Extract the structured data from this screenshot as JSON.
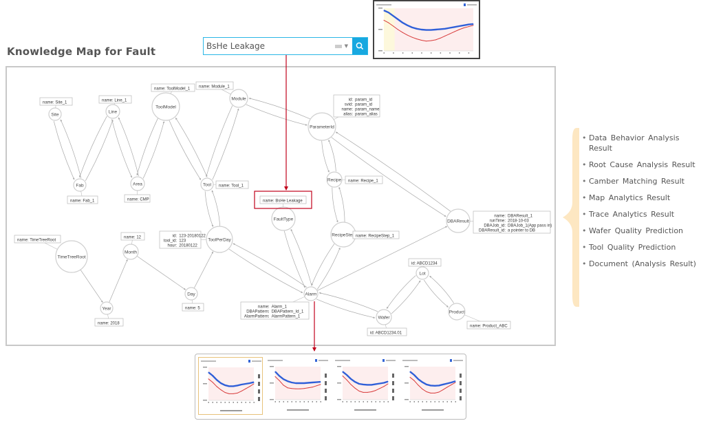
{
  "page": {
    "title": "Knowledge Map for Fault"
  },
  "search": {
    "value": "BsHe  Leakage",
    "icon": "search-icon"
  },
  "colors": {
    "accent": "#18a8e0",
    "highlight": "#c0001a",
    "node_stroke": "#cfcfcf",
    "edge": "#a8a8a8",
    "brace": "#fde7c2",
    "series_blue": "#2f5fd8",
    "series_red": "#d83a3a"
  },
  "graph": {
    "nodes": [
      {
        "id": "Site",
        "label": "Site"
      },
      {
        "id": "Line",
        "label": "Line"
      },
      {
        "id": "ToolModel",
        "label": "ToolModel"
      },
      {
        "id": "Module",
        "label": "Module"
      },
      {
        "id": "ParameterId",
        "label": "ParameterId"
      },
      {
        "id": "Fab",
        "label": "Fab"
      },
      {
        "id": "Area",
        "label": "Area"
      },
      {
        "id": "Tool",
        "label": "Tool"
      },
      {
        "id": "Recipe",
        "label": "Recipe"
      },
      {
        "id": "FaultType",
        "label": "FaultType"
      },
      {
        "id": "RecipeStep",
        "label": "RecipeStep"
      },
      {
        "id": "DBAResult",
        "label": "DBAResult"
      },
      {
        "id": "TimeTreeRoot",
        "label": "TimeTreeRoot"
      },
      {
        "id": "Month",
        "label": "Month"
      },
      {
        "id": "ToolPerDay",
        "label": "ToolPerDay"
      },
      {
        "id": "Year",
        "label": "Year"
      },
      {
        "id": "Day",
        "label": "Day"
      },
      {
        "id": "Alarm",
        "label": "Alarm"
      },
      {
        "id": "Lot",
        "label": "Lot"
      },
      {
        "id": "Wafer",
        "label": "Wafer"
      },
      {
        "id": "Product",
        "label": "Product"
      }
    ],
    "edges": [
      [
        "Site",
        "Fab"
      ],
      [
        "Fab",
        "Site"
      ],
      [
        "Line",
        "Fab"
      ],
      [
        "Fab",
        "Line"
      ],
      [
        "Line",
        "Area"
      ],
      [
        "Area",
        "Line"
      ],
      [
        "ToolModel",
        "Area"
      ],
      [
        "Area",
        "ToolModel"
      ],
      [
        "ToolModel",
        "Tool"
      ],
      [
        "Tool",
        "ToolModel"
      ],
      [
        "Module",
        "Tool"
      ],
      [
        "Tool",
        "Module"
      ],
      [
        "Module",
        "ParameterId"
      ],
      [
        "ParameterId",
        "Module"
      ],
      [
        "ParameterId",
        "Recipe"
      ],
      [
        "Recipe",
        "ParameterId"
      ],
      [
        "ParameterId",
        "DBAResult"
      ],
      [
        "DBAResult",
        "ParameterId"
      ],
      [
        "Recipe",
        "RecipeStep"
      ],
      [
        "RecipeStep",
        "Recipe"
      ],
      [
        "Tool",
        "ToolPerDay"
      ],
      [
        "ToolPerDay",
        "Tool"
      ],
      [
        "TimeTreeRoot",
        "Year"
      ],
      [
        "Year",
        "Month"
      ],
      [
        "Month",
        "Day"
      ],
      [
        "Day",
        "ToolPerDay"
      ],
      [
        "ToolPerDay",
        "Alarm"
      ],
      [
        "Alarm",
        "ToolPerDay"
      ],
      [
        "FaultType",
        "Alarm"
      ],
      [
        "Alarm",
        "FaultType"
      ],
      [
        "RecipeStep",
        "Alarm"
      ],
      [
        "Alarm",
        "RecipeStep"
      ],
      [
        "Alarm",
        "DBAResult"
      ],
      [
        "Wafer",
        "Alarm"
      ],
      [
        "Alarm",
        "Wafer"
      ],
      [
        "Lot",
        "Wafer"
      ],
      [
        "Wafer",
        "Lot"
      ],
      [
        "Lot",
        "Product"
      ],
      [
        "Product",
        "Lot"
      ]
    ],
    "properties": [
      {
        "node": "Site",
        "lines": [
          "name: Site_1"
        ]
      },
      {
        "node": "Line",
        "lines": [
          "name: Line_1"
        ]
      },
      {
        "node": "ToolModel",
        "lines": [
          "name: ToolModel_1"
        ]
      },
      {
        "node": "Module",
        "lines": [
          "name: Module_1"
        ]
      },
      {
        "node": "ParameterId",
        "lines": [
          "id: param_id",
          "svid: param_id",
          "name: param_name",
          "alias: param_alias"
        ]
      },
      {
        "node": "Fab",
        "lines": [
          "name: Fab_1"
        ]
      },
      {
        "node": "Area",
        "lines": [
          "name: CMP"
        ]
      },
      {
        "node": "Tool",
        "lines": [
          "name: Tool_1"
        ]
      },
      {
        "node": "Recipe",
        "lines": [
          "name: Recipe_1"
        ]
      },
      {
        "node": "FaultType",
        "lines": [
          "name: BsHe Leakage"
        ]
      },
      {
        "node": "RecipeStep",
        "lines": [
          "name: RecipeStep_1"
        ]
      },
      {
        "node": "DBAResult",
        "lines": [
          "name: DBAResult_1",
          "runTime: 2018-10-03",
          "DBAJob_id: DBAJob_1(App pass in)",
          "DBAResult_id: a pointer to DB"
        ]
      },
      {
        "node": "TimeTreeRoot",
        "lines": [
          "name: TimeTreeRoot"
        ]
      },
      {
        "node": "Month",
        "lines": [
          "name: 12"
        ]
      },
      {
        "node": "ToolPerDay",
        "lines": [
          "id: 123-20180122",
          "tool_id: 123",
          "hour: 20180122"
        ]
      },
      {
        "node": "Year",
        "lines": [
          "name: 2018"
        ]
      },
      {
        "node": "Day",
        "lines": [
          "name: 5"
        ]
      },
      {
        "node": "Alarm",
        "lines": [
          "name: Alarm_1",
          "DBAPattern: DBAPattern_Id_1",
          "AlarmPattern: AlarmPattern_1"
        ]
      },
      {
        "node": "Lot",
        "lines": [
          "id: ABCD1234"
        ]
      },
      {
        "node": "Wafer",
        "lines": [
          "id: ABCD1234.01"
        ]
      },
      {
        "node": "Product",
        "lines": [
          "name: Product_ABC"
        ]
      }
    ],
    "highlighted_property": "FaultType"
  },
  "results": {
    "items": [
      "Data Behavior Analysis Result",
      "Root Cause Analysis Result",
      "Camber Matching Result",
      "Map Analytics Result",
      "Trace Analytics Result",
      "Wafer Quality Prediction",
      "Tool Quality Prediction",
      "Document (Analysis Result)"
    ]
  },
  "chart_data": [
    {
      "type": "line",
      "title": "",
      "xlabel": "",
      "ylabel": "",
      "x": [
        1,
        2,
        3,
        4,
        5,
        6,
        7,
        8,
        9,
        10,
        11,
        12,
        13,
        14,
        15,
        16,
        17,
        18,
        19,
        20
      ],
      "series": [
        {
          "name": "upper",
          "color": "#2f5fd8",
          "values": [
            0.95,
            0.9,
            0.82,
            0.74,
            0.66,
            0.6,
            0.55,
            0.52,
            0.5,
            0.49,
            0.49,
            0.5,
            0.51,
            0.52,
            0.54,
            0.56,
            0.58,
            0.6,
            0.62,
            0.63
          ]
        },
        {
          "name": "lower",
          "color": "#d83a3a",
          "values": [
            0.72,
            0.66,
            0.58,
            0.5,
            0.43,
            0.37,
            0.32,
            0.28,
            0.25,
            0.23,
            0.24,
            0.26,
            0.3,
            0.35,
            0.4,
            0.45,
            0.5,
            0.54,
            0.57,
            0.6
          ]
        }
      ],
      "ylim": [
        0,
        1
      ],
      "grid": false,
      "legend": "top-right"
    },
    {
      "type": "line",
      "x": [
        1,
        2,
        3,
        4,
        5,
        6,
        7,
        8,
        9,
        10,
        11,
        12
      ],
      "series": [
        {
          "name": "upper",
          "color": "#2f5fd8",
          "values": [
            0.85,
            0.75,
            0.62,
            0.52,
            0.46,
            0.43,
            0.43,
            0.45,
            0.48,
            0.5,
            0.52,
            0.55
          ]
        },
        {
          "name": "lower",
          "color": "#d83a3a",
          "values": [
            0.65,
            0.55,
            0.42,
            0.32,
            0.24,
            0.2,
            0.2,
            0.22,
            0.28,
            0.35,
            0.42,
            0.5
          ]
        }
      ],
      "ylim": [
        0,
        1
      ],
      "legend": "top-right"
    },
    {
      "type": "line",
      "x": [
        1,
        2,
        3,
        4,
        5,
        6,
        7,
        8,
        9,
        10,
        11,
        12
      ],
      "series": [
        {
          "name": "upper",
          "color": "#2f5fd8",
          "values": [
            0.85,
            0.72,
            0.62,
            0.56,
            0.52,
            0.5,
            0.5,
            0.5,
            0.51,
            0.52,
            0.53,
            0.54
          ]
        },
        {
          "name": "lower",
          "color": "#d83a3a",
          "values": [
            0.7,
            0.58,
            0.44,
            0.36,
            0.34,
            0.33,
            0.33,
            0.34,
            0.36,
            0.38,
            0.42,
            0.46
          ]
        }
      ],
      "ylim": [
        0,
        1
      ],
      "legend": "top-right"
    },
    {
      "type": "line",
      "x": [
        1,
        2,
        3,
        4,
        5,
        6,
        7,
        8,
        9,
        10,
        11,
        12
      ],
      "series": [
        {
          "name": "upper",
          "color": "#2f5fd8",
          "values": [
            0.85,
            0.75,
            0.63,
            0.54,
            0.48,
            0.46,
            0.45,
            0.45,
            0.47,
            0.49,
            0.51,
            0.55
          ]
        },
        {
          "name": "lower",
          "color": "#d83a3a",
          "values": [
            0.72,
            0.6,
            0.46,
            0.35,
            0.26,
            0.22,
            0.22,
            0.24,
            0.28,
            0.34,
            0.4,
            0.48
          ]
        }
      ],
      "ylim": [
        0,
        1
      ],
      "legend": "top-right"
    },
    {
      "type": "line",
      "x": [
        1,
        2,
        3,
        4,
        5,
        6,
        7,
        8,
        9,
        10,
        11,
        12
      ],
      "series": [
        {
          "name": "upper",
          "color": "#2f5fd8",
          "values": [
            0.85,
            0.75,
            0.62,
            0.53,
            0.46,
            0.43,
            0.42,
            0.43,
            0.46,
            0.49,
            0.52,
            0.56
          ]
        },
        {
          "name": "lower",
          "color": "#d83a3a",
          "values": [
            0.68,
            0.58,
            0.44,
            0.32,
            0.24,
            0.2,
            0.2,
            0.23,
            0.3,
            0.38,
            0.45,
            0.52
          ]
        }
      ],
      "ylim": [
        0,
        1
      ],
      "legend": "top-right"
    }
  ]
}
